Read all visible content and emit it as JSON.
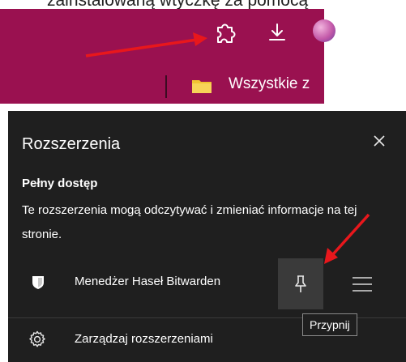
{
  "tutorial": {
    "cropped_line": "zainstalowaną wtyczkę za pomocą"
  },
  "toolbar": {
    "extensions_icon": "puzzle-icon",
    "download_icon": "download-icon",
    "bookmark_label": "Wszystkie z"
  },
  "panel": {
    "title": "Rozszerzenia",
    "close_icon": "close-icon",
    "section_title": "Pełny dostęp",
    "description": "Te rozszerzenia mogą odczytywać i zmieniać informacje na tej stronie.",
    "extension": {
      "name": "Menedżer Haseł Bitwarden",
      "pin_icon": "pin-icon",
      "menu_icon": "hamburger-menu-icon"
    },
    "manage_label": "Zarządzaj rozszerzeniami",
    "tooltip": "Przypnij"
  },
  "colors": {
    "toolbar_bg": "#9a1150",
    "panel_bg": "#1f1f1f",
    "annotation_arrow": "#e8171c"
  }
}
